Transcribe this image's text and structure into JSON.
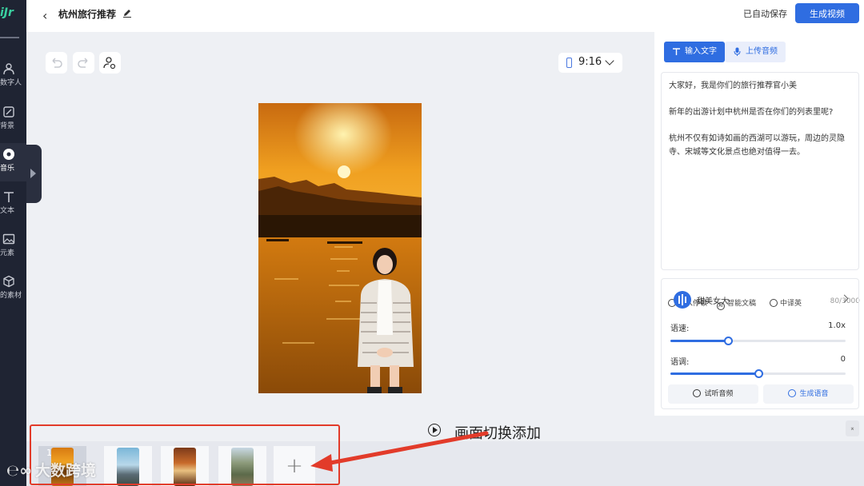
{
  "sidebar": {
    "logo": "iJr",
    "items": [
      {
        "label": "数字人",
        "icon": "person-icon"
      },
      {
        "label": "背景",
        "icon": "background-icon"
      },
      {
        "label": "音乐",
        "icon": "music-icon"
      },
      {
        "label": "文本",
        "icon": "text-icon"
      },
      {
        "label": "元素",
        "icon": "image-icon"
      },
      {
        "label": "的素材",
        "icon": "cube-icon"
      }
    ]
  },
  "header": {
    "title": "杭州旅行推荐",
    "autosave": "已自动保存",
    "generate_video": "生成视频"
  },
  "canvas": {
    "aspect_ratio": "9:16"
  },
  "right_panel": {
    "tabs": [
      {
        "label": "输入文字",
        "active": true
      },
      {
        "label": "上传音频",
        "active": false
      }
    ],
    "script": [
      "大家好，我是你们的旅行推荐官小美",
      "新年的出游计划中杭州是否在你们的列表里呢?",
      "杭州不仅有如诗如画的西湖可以游玩，周边的灵隐寺、宋城等文化景点也绝对值得一去。"
    ],
    "script_tools": {
      "insert_pause": "插入停顿",
      "ai_copy": "智能文稿",
      "translate": "中译英",
      "char_count": "80/3000"
    },
    "voice": {
      "name": "甜美女大",
      "speed_label": "语速:",
      "speed_value": "1.0x",
      "speed_level": 0.33,
      "pitch_label": "语调:",
      "pitch_value": "0",
      "pitch_level": 0.5,
      "preview_button": "试听音频",
      "generate_button": "生成语音"
    }
  },
  "timeline": {
    "annotation": "画面切换添加",
    "slides": [
      {
        "number": "1",
        "selected": true,
        "scene": "sunset"
      },
      {
        "number": "",
        "selected": false,
        "scene": "pagoda"
      },
      {
        "number": "",
        "selected": false,
        "scene": "food"
      },
      {
        "number": "",
        "selected": false,
        "scene": "temple"
      }
    ],
    "add_label": "+"
  },
  "watermark": "大数跨境",
  "colors": {
    "accent": "#2f6de1",
    "sidebar": "#1f2433",
    "annotation_red": "#e23b2a"
  }
}
